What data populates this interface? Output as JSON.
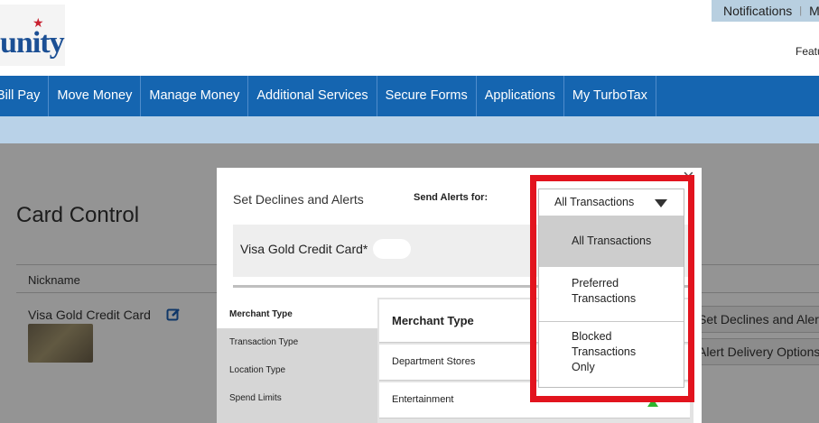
{
  "header": {
    "logo_text": "unity",
    "top_links": [
      "Notifications",
      "My"
    ],
    "feature_text": "Featu"
  },
  "nav": {
    "items": [
      "Bill Pay",
      "Move Money",
      "Manage Money",
      "Additional Services",
      "Secure Forms",
      "Applications",
      "My TurboTax"
    ]
  },
  "background": {
    "page_title": "Card Control",
    "nickname_label": "Nickname",
    "card_name": "Visa Gold Credit Card",
    "set_declines_btn": "Set Declines and Alerts",
    "alert_delivery_btn": "Alert Delivery Options"
  },
  "modal": {
    "title": "Set Declines and Alerts",
    "close_glyph": "×",
    "send_alerts_label": "Send Alerts for:",
    "card_label": "Visa Gold Credit Card*",
    "tabs": [
      "Merchant Type",
      "Transaction Type",
      "Location Type",
      "Spend Limits"
    ],
    "panel_header": "Merchant Type",
    "rows": [
      "Department Stores",
      "Entertainment"
    ],
    "select_value": "All Transactions",
    "options": [
      {
        "line1": "All Transactions"
      },
      {
        "line1": "Preferred",
        "line2": "Transactions"
      },
      {
        "line1": "Blocked",
        "line2": "Transactions",
        "line3": "Only"
      }
    ]
  },
  "colors": {
    "nav_blue": "#1565b0",
    "subbar_blue": "#b9d2e8",
    "highlight_red": "#e2141e",
    "status_green": "#2fb52f"
  }
}
